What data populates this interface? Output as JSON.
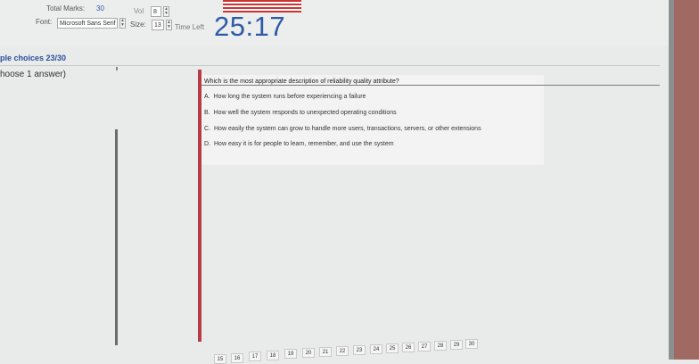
{
  "header": {
    "total_marks_label": "Total Marks:",
    "total_marks_value": "30",
    "vol_label": "Vol",
    "vol_value": "8",
    "font_label": "Font:",
    "font_value": "Microsoft Sans Serif",
    "size_label": "Size:",
    "size_value": "13",
    "time_left_label": "Time Left",
    "time_left_value": "25:17"
  },
  "section": {
    "title": "ple choices 23/30",
    "instruction": "hoose 1 answer)"
  },
  "question": {
    "text": "Which is the most appropriate description of reliability quality attribute?",
    "options": [
      {
        "key": "A.",
        "text": "How long the system runs before experiencing a failure"
      },
      {
        "key": "B.",
        "text": "How well the system responds to unexpected operating conditions"
      },
      {
        "key": "C.",
        "text": "How easily the system can grow to handle more users, transactions, servers, or other extensions"
      },
      {
        "key": "D.",
        "text": "How easy it is for people to learn, remember, and use the system"
      }
    ]
  },
  "pager": {
    "pages": [
      "15",
      "16",
      "17",
      "18",
      "19",
      "20",
      "21",
      "22",
      "23",
      "24",
      "25",
      "26",
      "27",
      "28",
      "29",
      "30"
    ]
  },
  "colors": {
    "timer": "#2f5aa6",
    "section_title": "#2c4f9c",
    "red_bar": "#b73b44"
  }
}
